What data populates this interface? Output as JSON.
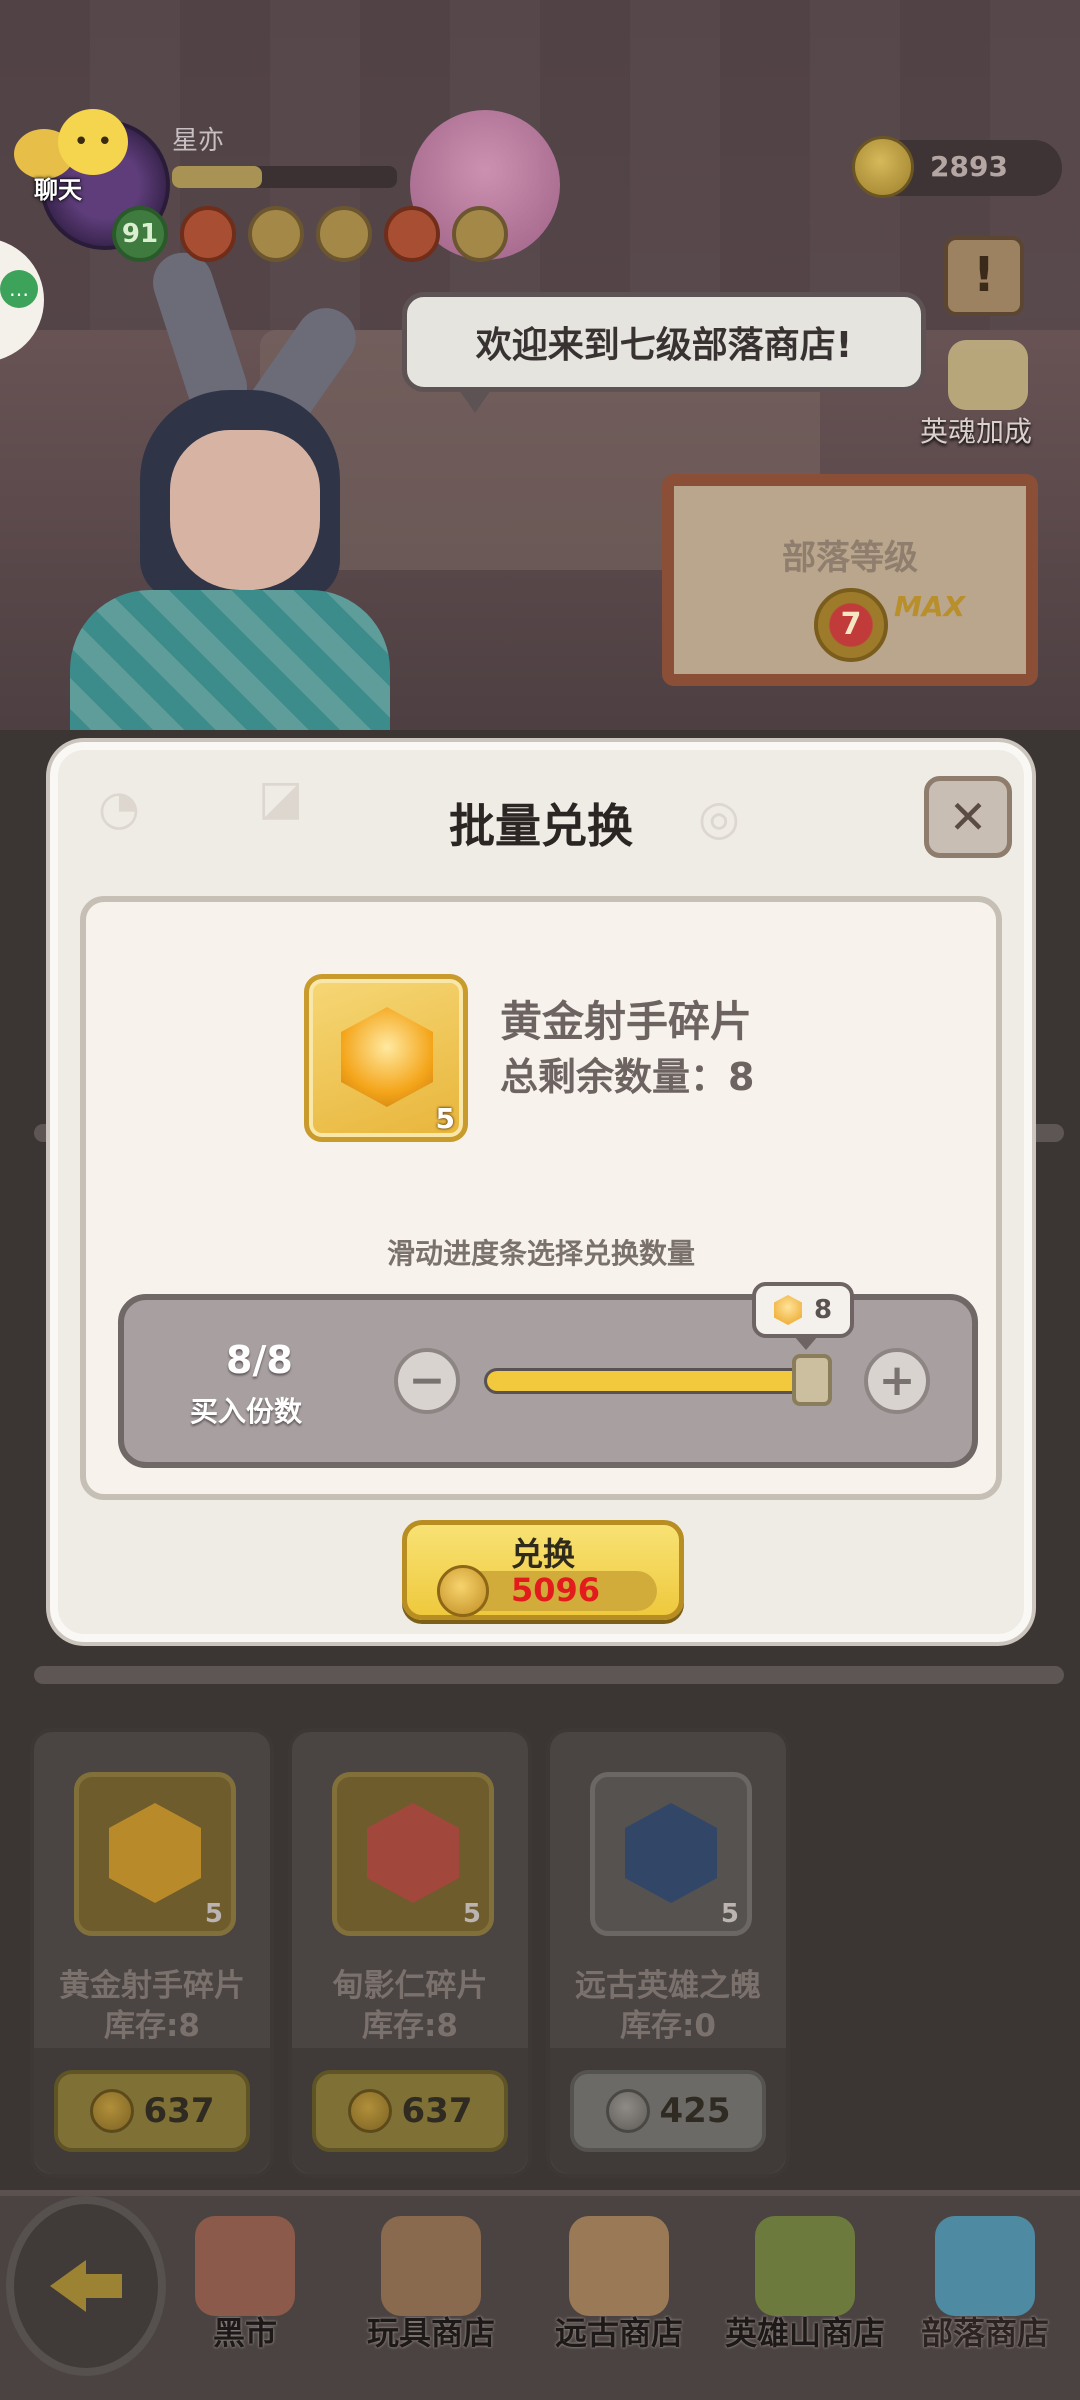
{
  "top": {
    "chat_label": "聊天",
    "player_name": "星亦",
    "level": "91",
    "coins": "2893",
    "hero_soul_label": "英魂加成",
    "npc_speech": "欢迎来到七级部落商店!",
    "tribe_level_title": "部落等级",
    "tribe_level_value": "7",
    "tribe_level_max": "MAX"
  },
  "modal": {
    "title": "批量兑换",
    "close_symbol": "✕",
    "item_name": "黄金射手碎片",
    "item_remaining": "总剩余数量：8",
    "item_badge_count": "5",
    "hint": "滑动进度条选择兑换数量",
    "quantity_fraction": "8/8",
    "quantity_label": "买入份数",
    "slider_tooltip_value": "8",
    "slider_value": 8,
    "slider_max": 8,
    "minus_symbol": "−",
    "plus_symbol": "+",
    "exchange_label": "兑换",
    "exchange_cost": "5096"
  },
  "shop_cards": [
    {
      "name": "黄金射手碎片",
      "stock": "库存:8",
      "count": "5",
      "price": "637",
      "currency": "gold",
      "gem_color": "#b88a2a"
    },
    {
      "name": "甸影仁碎片",
      "stock": "库存:8",
      "count": "5",
      "price": "637",
      "currency": "gold",
      "gem_color": "#a2473b"
    },
    {
      "name": "远古英雄之魄",
      "stock": "库存:0",
      "count": "5",
      "price": "425",
      "currency": "silver",
      "gem_color": "#324668"
    }
  ],
  "bottom_nav": [
    {
      "label": "黑市",
      "color": "#8b5a4a"
    },
    {
      "label": "玩具商店",
      "color": "#8a6a4e"
    },
    {
      "label": "远古商店",
      "color": "#9a7a56"
    },
    {
      "label": "英雄山商店",
      "color": "#6d7a3e"
    },
    {
      "label": "部落商店",
      "color": "#4f8aa3"
    }
  ]
}
